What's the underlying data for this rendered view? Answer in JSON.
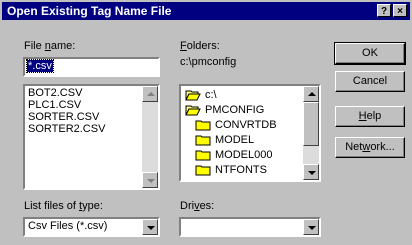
{
  "title": "Open Existing Tag Name File",
  "title_buttons": [
    "?",
    "×"
  ],
  "file_name": {
    "label_pre": "File ",
    "label_u": "n",
    "label_post": "ame:",
    "value": "*.csv"
  },
  "files": [
    "BOT2.CSV",
    "PLC1.CSV",
    "SORTER.CSV",
    "SORTER2.CSV"
  ],
  "folders": {
    "label_u": "F",
    "label_post": "olders:",
    "path": "c:\\pmconfig",
    "tree": [
      {
        "name": "c:\\",
        "icon": "open-folder-icon"
      },
      {
        "name": "PMCONFIG",
        "icon": "open-folder-icon"
      },
      {
        "name": "CONVRTDB",
        "icon": "folder-icon"
      },
      {
        "name": "MODEL",
        "icon": "folder-icon"
      },
      {
        "name": "MODEL000",
        "icon": "folder-icon"
      },
      {
        "name": "NTFONTS",
        "icon": "folder-icon"
      }
    ]
  },
  "buttons": {
    "ok": "OK",
    "cancel": "Cancel",
    "help_u": "H",
    "help_post": "elp",
    "network_pre": "Net",
    "network_u": "w",
    "network_post": "ork..."
  },
  "file_type": {
    "label_pre": "List files of ",
    "label_u": "t",
    "label_post": "ype:",
    "value": "Csv Files (*.csv)"
  },
  "drives": {
    "label_pre": "Dri",
    "label_u": "v",
    "label_post": "es:",
    "value": ""
  }
}
